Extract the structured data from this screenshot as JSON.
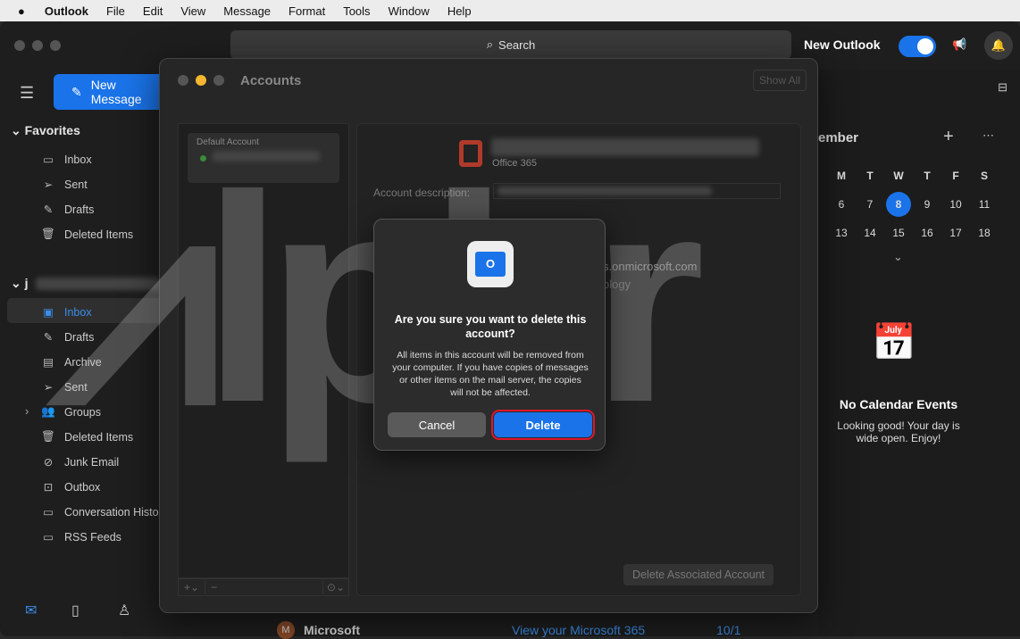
{
  "menubar": {
    "app": "Outlook",
    "items": [
      "File",
      "Edit",
      "View",
      "Message",
      "Format",
      "Tools",
      "Window",
      "Help"
    ]
  },
  "toolbar": {
    "search": "Search",
    "new_outlook": "New Outlook",
    "new_outlook_on": true,
    "new_message": "New Message"
  },
  "sidebar": {
    "favorites_label": "Favorites",
    "favorites": [
      {
        "label": "Inbox",
        "icon": "inbox-icon"
      },
      {
        "label": "Sent",
        "icon": "send-icon"
      },
      {
        "label": "Drafts",
        "icon": "pencil-icon"
      },
      {
        "label": "Deleted Items",
        "icon": "trash-icon"
      }
    ],
    "account_label": "j",
    "folders": [
      {
        "label": "Inbox",
        "icon": "inbox-icon",
        "selected": true
      },
      {
        "label": "Drafts",
        "icon": "pencil-icon"
      },
      {
        "label": "Archive",
        "icon": "archive-icon"
      },
      {
        "label": "Sent",
        "icon": "send-icon"
      },
      {
        "label": "Groups",
        "icon": "groups-icon"
      },
      {
        "label": "Deleted Items",
        "icon": "trash-icon"
      },
      {
        "label": "Junk Email",
        "icon": "junk-icon"
      },
      {
        "label": "Outbox",
        "icon": "outbox-icon"
      },
      {
        "label": "Conversation Histo",
        "icon": "folder-icon"
      },
      {
        "label": "RSS Feeds",
        "icon": "folder-icon"
      }
    ]
  },
  "accounts": {
    "title": "Accounts",
    "show_all": "Show All",
    "default_account": "Default Account",
    "account_type": "Office 365",
    "description_label": "Account description:",
    "email_suffix": "s.onmicrosoft.com",
    "partial": "ology",
    "delete_associated": "Delete Associated Account"
  },
  "alert": {
    "title": "Are you sure you want to delete this account?",
    "message": "All items in this account will be removed from your computer. If you have copies of messages or other items on the mail server, the copies will not be affected.",
    "cancel": "Cancel",
    "delete": "Delete"
  },
  "calendar": {
    "month": "ember",
    "days": [
      "M",
      "T",
      "W",
      "T",
      "F",
      "S"
    ],
    "rows": [
      [
        "6",
        "7",
        "8",
        "9",
        "10",
        "11"
      ],
      [
        "13",
        "14",
        "15",
        "16",
        "17",
        "18"
      ]
    ],
    "today": "8",
    "no_events": "No Calendar Events",
    "no_events_sub": "Looking good! Your day is wide open. Enjoy!"
  },
  "message_list": {
    "sender": "Microsoft",
    "avatar": "M",
    "subject": "View your Microsoft 365",
    "date": "10/1"
  },
  "watermark": "Alphr",
  "colors": {
    "accent": "#1a73e8",
    "highlight": "#e0162b"
  }
}
